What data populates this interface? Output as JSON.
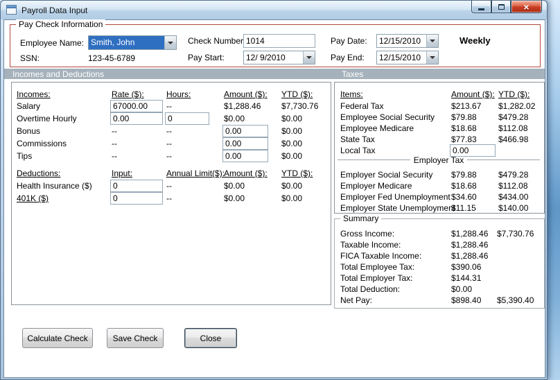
{
  "window": {
    "title": "Payroll Data Input",
    "icons": {
      "close": "×"
    }
  },
  "paycheck": {
    "legend": "Pay Check Information",
    "employee_name": {
      "label": "Employee Name:",
      "value": "Smith, John"
    },
    "ssn": {
      "label": "SSN:",
      "value": "123-45-6789"
    },
    "check_number": {
      "label": "Check Number:",
      "value": "1014"
    },
    "pay_start": {
      "label": "Pay Start:",
      "value": "12/ 9/2010"
    },
    "pay_date": {
      "label": "Pay Date:",
      "value": "12/15/2010"
    },
    "pay_end": {
      "label": "Pay End:",
      "value": "12/15/2010"
    },
    "frequency": "Weekly"
  },
  "sections": {
    "incomes_and_deductions": "Incomes and Deductions",
    "taxes": "Taxes"
  },
  "incomes": {
    "headers": {
      "item": "Incomes:",
      "rate": "Rate ($):",
      "hours": "Hours:",
      "amount": "Amount ($):",
      "ytd": "YTD ($):"
    },
    "rows": [
      {
        "label": "Salary",
        "rate": "67000.00",
        "hours": "--",
        "amount": "$1,288.46",
        "ytd": "$7,730.76"
      },
      {
        "label": "Overtime Hourly",
        "rate": "0.00",
        "hours": "0",
        "amount": "$0.00",
        "ytd": "$0.00"
      },
      {
        "label": "Bonus",
        "rate": "--",
        "hours": "--",
        "amount": "0.00",
        "ytd": "$0.00"
      },
      {
        "label": "Commissions",
        "rate": "--",
        "hours": "--",
        "amount": "0.00",
        "ytd": "$0.00"
      },
      {
        "label": "Tips",
        "rate": "--",
        "hours": "--",
        "amount": "0.00",
        "ytd": "$0.00"
      }
    ]
  },
  "deductions": {
    "headers": {
      "item": "Deductions:",
      "input": "Input:",
      "limit": "Annual Limit($):",
      "amount": "Amount ($):",
      "ytd": "YTD ($):"
    },
    "rows": [
      {
        "label": "Health Insurance  ($)",
        "input": "0",
        "limit": "--",
        "amount": "$0.00",
        "ytd": "$0.00"
      },
      {
        "label": "401K  ($)",
        "input": "0",
        "limit": "--",
        "amount": "$0.00",
        "ytd": "$0.00"
      }
    ]
  },
  "taxes": {
    "headers": {
      "item": "Items:",
      "amount": "Amount ($):",
      "ytd": "YTD ($):"
    },
    "employee_rows": [
      {
        "label": "Federal Tax",
        "amount": "$213.67",
        "ytd": "$1,282.02"
      },
      {
        "label": "Employee Social Security",
        "amount": "$79.88",
        "ytd": "$479.28"
      },
      {
        "label": "Employee Medicare",
        "amount": "$18.68",
        "ytd": "$112.08"
      },
      {
        "label": "State Tax",
        "amount": "$77.83",
        "ytd": "$466.98"
      }
    ],
    "local_tax": {
      "label": "Local Tax",
      "input": "0.00"
    },
    "employer_header": "Employer Tax",
    "employer_rows": [
      {
        "label": "Employer Social Security",
        "amount": "$79.88",
        "ytd": "$479.28"
      },
      {
        "label": "Employer Medicare",
        "amount": "$18.68",
        "ytd": "$112.08"
      },
      {
        "label": "Employer Fed Unemployment",
        "amount": "$34.60",
        "ytd": "$434.00"
      },
      {
        "label": "Employer State Unemployment",
        "amount": "$11.15",
        "ytd": "$140.00"
      }
    ]
  },
  "summary": {
    "legend": "Summary",
    "rows": [
      {
        "label": "Gross Income:",
        "amount": "$1,288.46",
        "ytd": "$7,730.76"
      },
      {
        "label": "Taxable Income:",
        "amount": "$1,288.46",
        "ytd": ""
      },
      {
        "label": "FICA Taxable Income:",
        "amount": "$1,288.46",
        "ytd": ""
      },
      {
        "label": "Total Employee Tax:",
        "amount": "$390.06",
        "ytd": ""
      },
      {
        "label": "Total Employer Tax:",
        "amount": "$144.31",
        "ytd": ""
      },
      {
        "label": "Total Deduction:",
        "amount": "$0.00",
        "ytd": ""
      },
      {
        "label": "Net Pay:",
        "amount": "$898.40",
        "ytd": "$5,390.40"
      }
    ]
  },
  "buttons": {
    "calculate": "Calculate Check",
    "save": "Save Check",
    "close": "Close"
  },
  "colors": {
    "section_band": "#a5b2bc",
    "paycheck_border": "#b0493a",
    "selection_blue": "#2f6fc1",
    "close_button_red": "#c83c22"
  }
}
